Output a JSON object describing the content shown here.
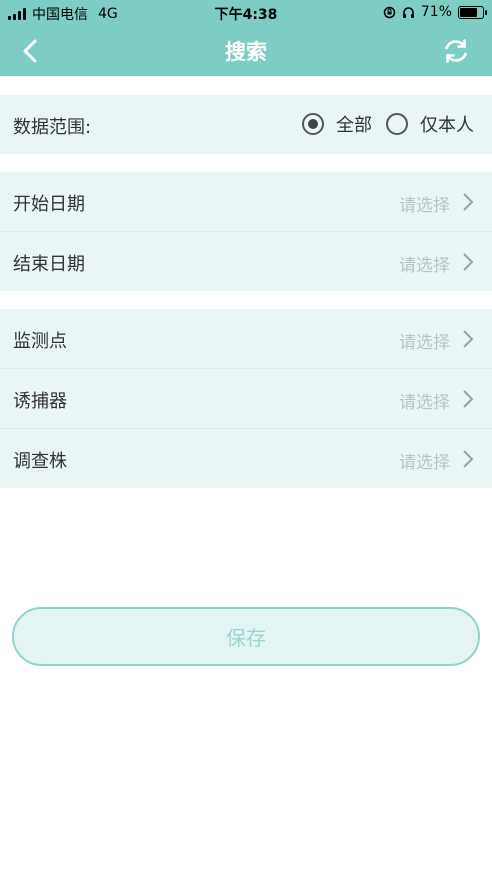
{
  "status_bar": {
    "carrier": "中国电信",
    "network": "4G",
    "time": "下午4:38",
    "battery": "71%"
  },
  "nav": {
    "title": "搜索"
  },
  "scope": {
    "label": "数据范围:",
    "options": [
      {
        "label": "全部",
        "selected": true
      },
      {
        "label": "仅本人",
        "selected": false
      }
    ]
  },
  "dates": [
    {
      "label": "开始日期",
      "hint": "请选择"
    },
    {
      "label": "结束日期",
      "hint": "请选择"
    }
  ],
  "fields": [
    {
      "label": "监测点",
      "hint": "请选择"
    },
    {
      "label": "诱捕器",
      "hint": "请选择"
    },
    {
      "label": "调查株",
      "hint": "请选择"
    }
  ],
  "save_label": "保存",
  "colors": {
    "header": "#7ecdc4",
    "row_bg": "#eaf6f6",
    "hint": "#b9c4c4",
    "save_text": "#9fd3cf"
  },
  "icons": {
    "back": "chevron-left-icon",
    "refresh": "refresh-icon",
    "row_arrow": "chevron-right-icon"
  }
}
